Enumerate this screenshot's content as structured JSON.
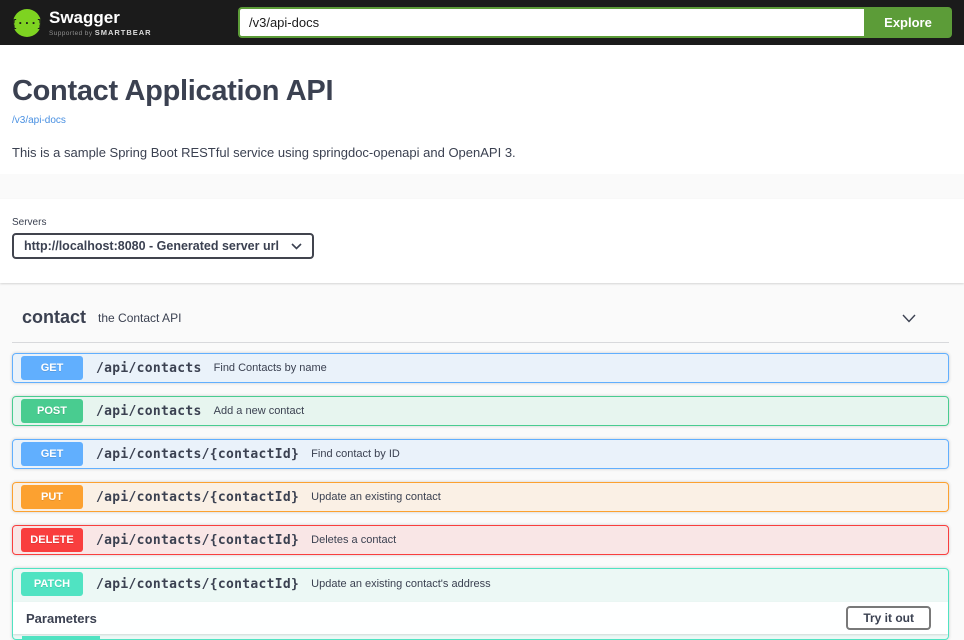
{
  "topbar": {
    "logo_text": "Swagger",
    "logo_sub_prefix": "Supported by",
    "logo_sub_brand": "SMARTBEAR",
    "url_value": "/v3/api-docs",
    "explore_label": "Explore",
    "colors": {
      "bar": "#1b1b1b",
      "accent_green": "#5c9c38",
      "logo_green": "#7ed321"
    }
  },
  "info": {
    "title": "Contact Application API",
    "spec_link": "/v3/api-docs",
    "description": "This is a sample Spring Boot RESTful service using springdoc-openapi and OpenAPI 3."
  },
  "servers": {
    "label": "Servers",
    "selected": "http://localhost:8080 - Generated server url"
  },
  "tag": {
    "name": "contact",
    "description": "the Contact API"
  },
  "operations": [
    {
      "method": "GET",
      "path": "/api/contacts",
      "summary": "Find Contacts by name",
      "color": "#61affe",
      "expanded": false
    },
    {
      "method": "POST",
      "path": "/api/contacts",
      "summary": "Add a new contact",
      "color": "#49cc90",
      "expanded": false
    },
    {
      "method": "GET",
      "path": "/api/contacts/{contactId}",
      "summary": "Find contact by ID",
      "color": "#61affe",
      "expanded": false
    },
    {
      "method": "PUT",
      "path": "/api/contacts/{contactId}",
      "summary": "Update an existing contact",
      "color": "#fca130",
      "expanded": false
    },
    {
      "method": "DELETE",
      "path": "/api/contacts/{contactId}",
      "summary": "Deletes a contact",
      "color": "#f93e3e",
      "expanded": false
    },
    {
      "method": "PATCH",
      "path": "/api/contacts/{contactId}",
      "summary": "Update an existing contact's address",
      "color": "#50e3c2",
      "expanded": true
    }
  ],
  "expanded_panel": {
    "parameters_label": "Parameters",
    "try_it_out_label": "Try it out"
  }
}
